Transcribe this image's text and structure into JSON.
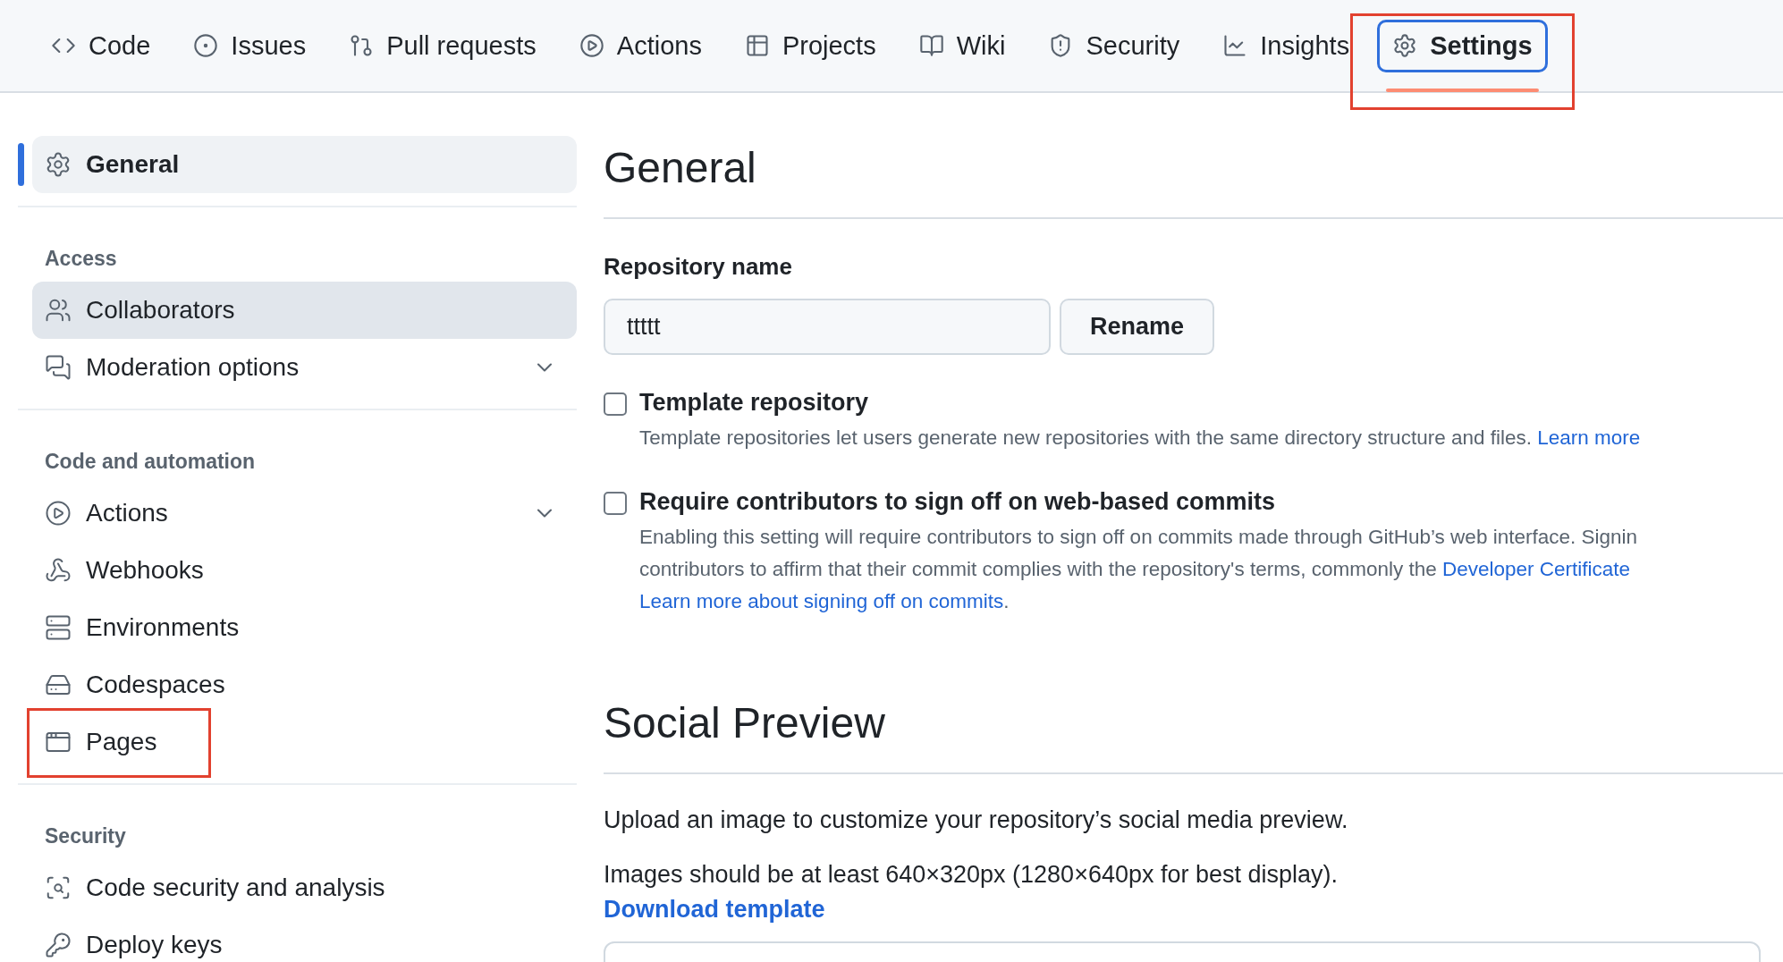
{
  "repo_nav": {
    "tabs": [
      {
        "label": "Code",
        "selected": false,
        "focused": false,
        "annotated": false
      },
      {
        "label": "Issues",
        "selected": false,
        "focused": false,
        "annotated": false
      },
      {
        "label": "Pull requests",
        "selected": false,
        "focused": false,
        "annotated": false
      },
      {
        "label": "Actions",
        "selected": false,
        "focused": false,
        "annotated": false
      },
      {
        "label": "Projects",
        "selected": false,
        "focused": false,
        "annotated": false
      },
      {
        "label": "Wiki",
        "selected": false,
        "focused": false,
        "annotated": false
      },
      {
        "label": "Security",
        "selected": false,
        "focused": false,
        "annotated": false
      },
      {
        "label": "Insights",
        "selected": false,
        "focused": false,
        "annotated": false
      },
      {
        "label": "Settings",
        "selected": true,
        "focused": true,
        "annotated": true
      }
    ]
  },
  "sidebar": {
    "sections": [
      {
        "items": [
          {
            "label": "General",
            "kind": "link",
            "selected": true,
            "hovered": false,
            "annotated": false
          }
        ]
      },
      {
        "heading": "Access",
        "items": [
          {
            "label": "Collaborators",
            "kind": "link",
            "selected": false,
            "hovered": true,
            "annotated": false
          },
          {
            "label": "Moderation options",
            "kind": "group",
            "selected": false,
            "hovered": false,
            "annotated": false
          }
        ]
      },
      {
        "heading": "Code and automation",
        "items": [
          {
            "label": "Actions",
            "kind": "group",
            "selected": false,
            "hovered": false,
            "annotated": false
          },
          {
            "label": "Webhooks",
            "kind": "link",
            "selected": false,
            "hovered": false,
            "annotated": false
          },
          {
            "label": "Environments",
            "kind": "link",
            "selected": false,
            "hovered": false,
            "annotated": false
          },
          {
            "label": "Codespaces",
            "kind": "link",
            "selected": false,
            "hovered": false,
            "annotated": false
          },
          {
            "label": "Pages",
            "kind": "link",
            "selected": false,
            "hovered": false,
            "annotated": true
          }
        ]
      },
      {
        "heading": "Security",
        "items": [
          {
            "label": "Code security and analysis",
            "kind": "link",
            "selected": false,
            "hovered": false,
            "annotated": false
          },
          {
            "label": "Deploy keys",
            "kind": "link",
            "selected": false,
            "hovered": false,
            "annotated": false
          }
        ]
      }
    ]
  },
  "general": {
    "title": "General",
    "repository_name": {
      "label": "Repository name",
      "value": "ttttt",
      "button": "Rename"
    },
    "options": [
      {
        "label": "Template repository",
        "checked": false,
        "lines": [
          [
            {
              "text": "Template repositories let users generate new repositories with the same directory structure and files. ",
              "kind": "text"
            },
            {
              "text": "Learn more",
              "kind": "link"
            }
          ]
        ]
      },
      {
        "label": "Require contributors to sign off on web-based commits",
        "checked": false,
        "lines": [
          [
            {
              "text": "Enabling this setting will require contributors to sign off on commits made through GitHub’s web interface. Signin",
              "kind": "text"
            }
          ],
          [
            {
              "text": "contributors to affirm that their commit complies with the repository's terms, commonly the ",
              "kind": "text"
            },
            {
              "text": "Developer Certificate",
              "kind": "link"
            }
          ],
          [
            {
              "text": "Learn more about signing off on commits",
              "kind": "link"
            },
            {
              "text": ".",
              "kind": "text"
            }
          ]
        ]
      }
    ]
  },
  "social_preview": {
    "title": "Social Preview",
    "paragraphs": [
      "Upload an image to customize your repository’s social media preview.",
      "Images should be at least 640×320px (1280×640px for best display)."
    ],
    "link": "Download template"
  }
}
